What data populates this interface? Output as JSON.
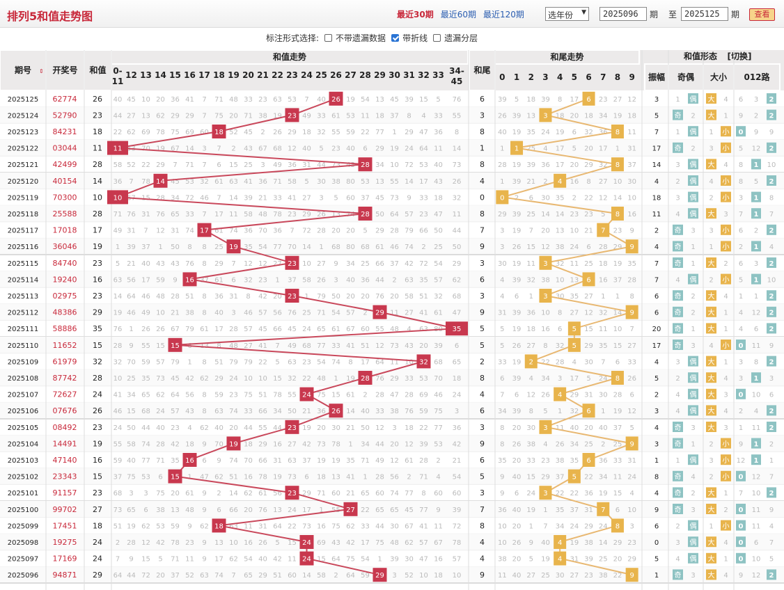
{
  "title": "排列5和值走势图",
  "periods": [
    "最近30期",
    "最近60期",
    "最近120期"
  ],
  "active_period": 0,
  "year_select": "选年份",
  "range_from": "2025096",
  "label_qi": "期",
  "label_to": "至",
  "range_to": "2025125",
  "query_btn": "查看",
  "options_label": "标注形式选择:",
  "options": [
    {
      "label": "不带遗漏数据",
      "checked": false
    },
    {
      "label": "带折线",
      "checked": true
    },
    {
      "label": "遗漏分层",
      "checked": false
    }
  ],
  "headers": {
    "qihao": "期号",
    "kaijiang": "开奖号",
    "hezhi": "和值",
    "trend": "和值走势",
    "hewei": "和尾",
    "wei_trend": "和尾走势",
    "form": "和值形态",
    "switch": "[切换]",
    "zhenfu": "振幅",
    "jiou": "奇偶",
    "daxiao": "大小",
    "lu": "012路"
  },
  "sum_cols": [
    "0-11",
    "12",
    "13",
    "14",
    "15",
    "16",
    "17",
    "18",
    "19",
    "20",
    "21",
    "22",
    "23",
    "24",
    "25",
    "26",
    "27",
    "28",
    "29",
    "30",
    "31",
    "32",
    "33",
    "34-45"
  ],
  "labels": {
    "odd": "奇",
    "even": "偶",
    "big": "大",
    "small": "小"
  },
  "rows": [
    [
      "2025125",
      "62774",
      26,
      6,
      3
    ],
    [
      "2025124",
      "52790",
      23,
      3,
      5
    ],
    [
      "2025123",
      "84231",
      18,
      8,
      7
    ],
    [
      "2025122",
      "03044",
      11,
      1,
      17
    ],
    [
      "2025121",
      "42499",
      28,
      8,
      14
    ],
    [
      "2025120",
      "40154",
      14,
      4,
      4
    ],
    [
      "2025119",
      "70300",
      10,
      0,
      18
    ],
    [
      "2025118",
      "25588",
      28,
      8,
      11
    ],
    [
      "2025117",
      "17018",
      17,
      7,
      2
    ],
    [
      "2025116",
      "36046",
      19,
      9,
      4
    ],
    [
      "2025115",
      "84740",
      23,
      3,
      7
    ],
    [
      "2025114",
      "19240",
      16,
      6,
      7
    ],
    [
      "2025113",
      "02975",
      23,
      3,
      6
    ],
    [
      "2025112",
      "48386",
      29,
      9,
      6
    ],
    [
      "2025111",
      "58886",
      35,
      5,
      20
    ],
    [
      "2025110",
      "11652",
      15,
      5,
      17
    ],
    [
      "2025109",
      "61979",
      32,
      2,
      4
    ],
    [
      "2025108",
      "87742",
      28,
      8,
      5
    ],
    [
      "2025107",
      "72627",
      24,
      4,
      2
    ],
    [
      "2025106",
      "07676",
      26,
      6,
      3
    ],
    [
      "2025105",
      "08492",
      23,
      3,
      4
    ],
    [
      "2025104",
      "14491",
      19,
      9,
      3
    ],
    [
      "2025103",
      "47140",
      16,
      6,
      1
    ],
    [
      "2025102",
      "23343",
      15,
      5,
      8
    ],
    [
      "2025101",
      "91157",
      23,
      3,
      4
    ],
    [
      "2025100",
      "99702",
      27,
      7,
      9
    ],
    [
      "2025099",
      "17451",
      18,
      8,
      6
    ],
    [
      "2025098",
      "19275",
      24,
      4,
      0
    ],
    [
      "2025097",
      "17169",
      24,
      4,
      5
    ],
    [
      "2025096",
      "94871",
      29,
      9,
      1
    ]
  ]
}
